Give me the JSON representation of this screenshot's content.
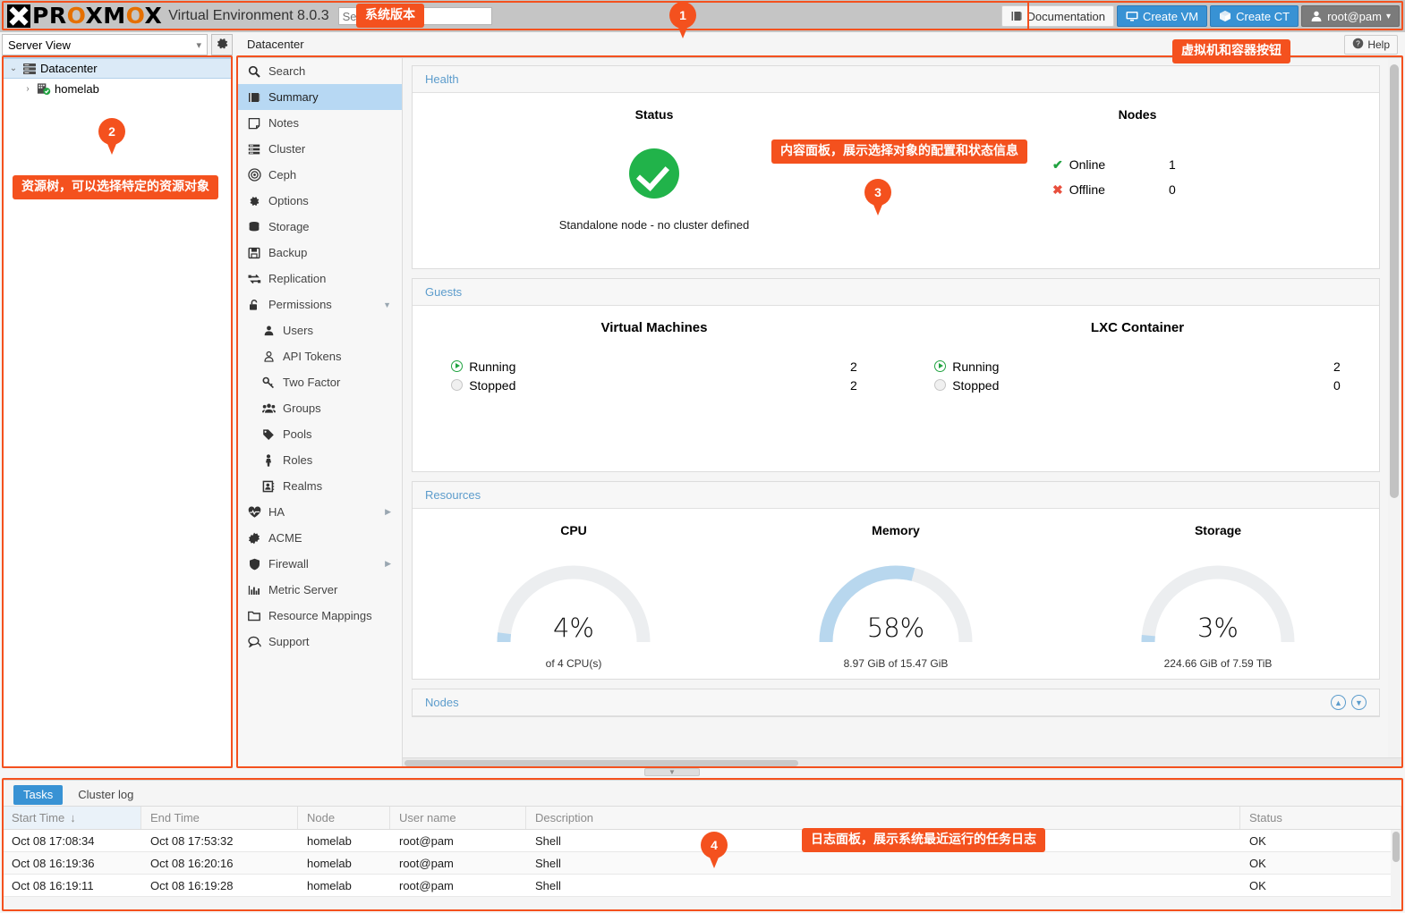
{
  "header": {
    "logo_main": "PR",
    "logo_o1": "O",
    "logo_mid": "XM",
    "logo_o2": "O",
    "logo_end": "X",
    "product": "Virtual Environment 8.0.3",
    "search_placeholder": "Search",
    "search_value": "",
    "documentation": "Documentation",
    "create_vm": "Create VM",
    "create_ct": "Create CT",
    "user": "root@pam"
  },
  "toolbar": {
    "view_select": "Server View",
    "breadcrumb": "Datacenter",
    "help": "Help"
  },
  "tree": {
    "items": [
      {
        "label": "Datacenter",
        "icon": "datacenter-icon",
        "selected": true,
        "depth": 0,
        "twisty": "⌄"
      },
      {
        "label": "homelab",
        "icon": "node-icon",
        "selected": false,
        "depth": 1,
        "twisty": "›"
      }
    ]
  },
  "nav": {
    "items": [
      {
        "label": "Search",
        "icon": "search-icon",
        "active": false,
        "sub": false,
        "arrow": ""
      },
      {
        "label": "Summary",
        "icon": "summary-icon",
        "active": true,
        "sub": false,
        "arrow": ""
      },
      {
        "label": "Notes",
        "icon": "notes-icon",
        "active": false,
        "sub": false,
        "arrow": ""
      },
      {
        "label": "Cluster",
        "icon": "cluster-icon",
        "active": false,
        "sub": false,
        "arrow": ""
      },
      {
        "label": "Ceph",
        "icon": "ceph-icon",
        "active": false,
        "sub": false,
        "arrow": ""
      },
      {
        "label": "Options",
        "icon": "gear-icon",
        "active": false,
        "sub": false,
        "arrow": ""
      },
      {
        "label": "Storage",
        "icon": "storage-icon",
        "active": false,
        "sub": false,
        "arrow": ""
      },
      {
        "label": "Backup",
        "icon": "backup-icon",
        "active": false,
        "sub": false,
        "arrow": ""
      },
      {
        "label": "Replication",
        "icon": "replication-icon",
        "active": false,
        "sub": false,
        "arrow": ""
      },
      {
        "label": "Permissions",
        "icon": "unlock-icon",
        "active": false,
        "sub": false,
        "arrow": "▼"
      },
      {
        "label": "Users",
        "icon": "user-icon",
        "active": false,
        "sub": true,
        "arrow": ""
      },
      {
        "label": "API Tokens",
        "icon": "api-token-icon",
        "active": false,
        "sub": true,
        "arrow": ""
      },
      {
        "label": "Two Factor",
        "icon": "key-icon",
        "active": false,
        "sub": true,
        "arrow": ""
      },
      {
        "label": "Groups",
        "icon": "groups-icon",
        "active": false,
        "sub": true,
        "arrow": ""
      },
      {
        "label": "Pools",
        "icon": "tag-icon",
        "active": false,
        "sub": true,
        "arrow": ""
      },
      {
        "label": "Roles",
        "icon": "roles-icon",
        "active": false,
        "sub": true,
        "arrow": ""
      },
      {
        "label": "Realms",
        "icon": "realms-icon",
        "active": false,
        "sub": true,
        "arrow": ""
      },
      {
        "label": "HA",
        "icon": "heartbeat-icon",
        "active": false,
        "sub": false,
        "arrow": "▶"
      },
      {
        "label": "ACME",
        "icon": "acme-icon",
        "active": false,
        "sub": false,
        "arrow": ""
      },
      {
        "label": "Firewall",
        "icon": "shield-icon",
        "active": false,
        "sub": false,
        "arrow": "▶"
      },
      {
        "label": "Metric Server",
        "icon": "chart-icon",
        "active": false,
        "sub": false,
        "arrow": ""
      },
      {
        "label": "Resource Mappings",
        "icon": "folder-icon",
        "active": false,
        "sub": false,
        "arrow": ""
      },
      {
        "label": "Support",
        "icon": "support-icon",
        "active": false,
        "sub": false,
        "arrow": ""
      }
    ]
  },
  "main": {
    "health": {
      "title": "Health",
      "status_title": "Status",
      "status_icon": "green-check-circle",
      "status_text": "Standalone node - no cluster defined",
      "nodes_title": "Nodes",
      "rows": [
        {
          "label": "Online",
          "value": "1",
          "mark": "✔",
          "state": "ok"
        },
        {
          "label": "Offline",
          "value": "0",
          "mark": "✖",
          "state": "bad"
        }
      ]
    },
    "guests": {
      "title": "Guests",
      "vm_title": "Virtual Machines",
      "ct_title": "LXC Container",
      "vm_rows": [
        {
          "label": "Running",
          "value": "2",
          "state": "running"
        },
        {
          "label": "Stopped",
          "value": "2",
          "state": "stopped"
        }
      ],
      "ct_rows": [
        {
          "label": "Running",
          "value": "2",
          "state": "running"
        },
        {
          "label": "Stopped",
          "value": "0",
          "state": "stopped"
        }
      ]
    },
    "resources": {
      "title": "Resources",
      "gauges": [
        {
          "title": "CPU",
          "percent": 4,
          "value_text": "4%",
          "sub": "of 4 CPU(s)"
        },
        {
          "title": "Memory",
          "percent": 58,
          "value_text": "58%",
          "sub": "8.97 GiB of 15.47 GiB"
        },
        {
          "title": "Storage",
          "percent": 3,
          "value_text": "3%",
          "sub": "224.66 GiB of 7.59 TiB"
        }
      ]
    },
    "nodes_section": {
      "title": "Nodes",
      "up_icon": "chevron-up-icon",
      "down_icon": "chevron-down-icon"
    }
  },
  "log": {
    "tabs": [
      {
        "label": "Tasks",
        "active": true
      },
      {
        "label": "Cluster log",
        "active": false
      }
    ],
    "columns": [
      "Start Time",
      "End Time",
      "Node",
      "User name",
      "Description",
      "Status"
    ],
    "sort_indicator": "↓",
    "rows": [
      {
        "start": "Oct 08 17:08:34",
        "end": "Oct 08 17:53:32",
        "node": "homelab",
        "user": "root@pam",
        "desc": "Shell",
        "status": "OK"
      },
      {
        "start": "Oct 08 16:19:36",
        "end": "Oct 08 16:20:16",
        "node": "homelab",
        "user": "root@pam",
        "desc": "Shell",
        "status": "OK"
      },
      {
        "start": "Oct 08 16:19:11",
        "end": "Oct 08 16:19:28",
        "node": "homelab",
        "user": "root@pam",
        "desc": "Shell",
        "status": "OK"
      }
    ]
  },
  "annotations": {
    "accent": "#f4511e",
    "pins": [
      {
        "num": "1"
      },
      {
        "num": "2"
      },
      {
        "num": "3"
      },
      {
        "num": "4"
      }
    ],
    "labels": {
      "version": "系统版本",
      "vm_ct_buttons": "虚拟机和容器按钮",
      "resource_tree": "资源树，可以选择特定的资源对象",
      "content_panel": "内容面板，展示选择对象的配置和状态信息",
      "log_panel": "日志面板，展示系统最近运行的任务日志"
    }
  }
}
